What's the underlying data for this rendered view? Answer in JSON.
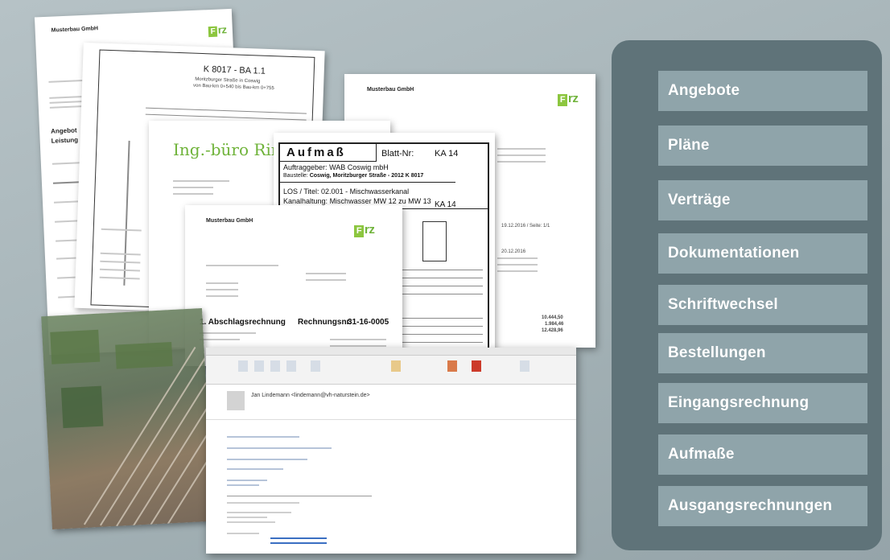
{
  "colors": {
    "panel": "#5f7379",
    "menu_item": "#8fa4aa",
    "menu_text": "#ffffff",
    "logo_green": "#8cc63f"
  },
  "menu": {
    "items": [
      {
        "label": "Angebote"
      },
      {
        "label": "Pläne"
      },
      {
        "label": "Verträge"
      },
      {
        "label": "Dokumentationen"
      },
      {
        "label": "Schriftwechsel"
      },
      {
        "label": "Bestellungen"
      },
      {
        "label": "Eingangsrechnung"
      },
      {
        "label": "Aufmaße"
      },
      {
        "label": "Ausgangsrechnungen"
      }
    ]
  },
  "documents": {
    "company": "Musterbau GmbH",
    "logo": "rz",
    "plan_title": "K 8017 - BA 1.1",
    "plan_sub1": "Moritzburger Straße in Coswig",
    "plan_sub2": "von Bau-km 0+540 bis Bau-km 0+755",
    "ing_buero": "Ing.-büro Rink",
    "aufmass_title": "Aufmaß",
    "blatt_label": "Blatt-Nr:",
    "blatt_value": "KA 14",
    "auftraggeber_label": "Auftraggeber:",
    "auftraggeber_value": "WAB Coswig mbH",
    "bauvorhaben_label": "Baustelle:",
    "bauvorhaben_value": "Coswig, Moritzburger Straße - 2012 K 8017",
    "los_label": "LOS / Titel:",
    "los_value": "02.001 - Mischwasserkanal",
    "kanal_label": "Kanalhaltung:",
    "kanal_value": "Mischwasser MW 12 zu MW 13",
    "aufmass_nr_value": "KA 14",
    "rechnung_title": "1. Abschlagsrechnung",
    "rechnung_nr_label": "Rechnungsnr.",
    "rechnung_nr_value": "31-16-0005",
    "angebot_label": "Angebot",
    "leistung_label": "Leistung",
    "summe_1": "10.444,50",
    "summe_2": "1.984,46",
    "summe_3": "12.428,96",
    "date_1": "19.12.2016 / Seite: 1/1",
    "date_2": "20.12.2016"
  },
  "mail": {
    "sender": "Jan Lindemann <lindemann@vh-naturstein.de>"
  }
}
